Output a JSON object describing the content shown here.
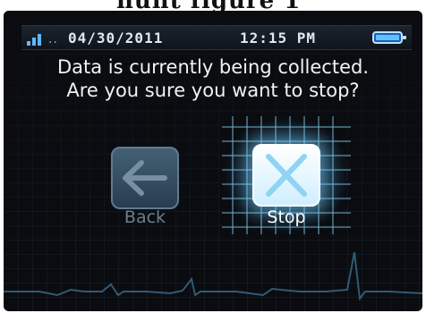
{
  "statusbar": {
    "date": "04/30/2011",
    "time": "12:15 PM",
    "signal_icon": "signal-strength-icon",
    "battery_icon": "battery-full-icon"
  },
  "dialog": {
    "line1": "Data is currently being collected.",
    "line2": "Are you sure you want to stop?"
  },
  "buttons": {
    "back_label": "Back",
    "back_icon": "back-arrow-icon",
    "stop_label": "Stop",
    "stop_icon": "stop-x-icon"
  },
  "colors": {
    "accent": "#5fc0ff",
    "screen_bg": "#0a0c10"
  }
}
